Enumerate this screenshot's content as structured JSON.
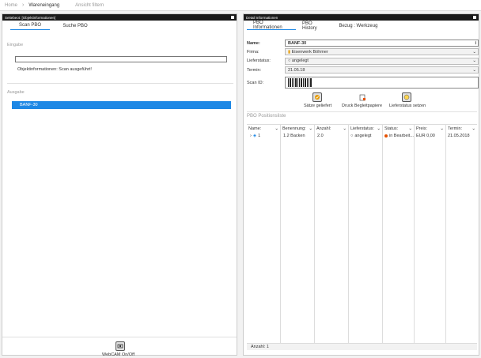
{
  "topbar": {
    "home": "Home",
    "current": "Wareneingang",
    "filter": "Ansicht filtern"
  },
  "left_panel": {
    "header": "Seitebeot: [Objektinformationen]",
    "tabs": [
      "Scan PBO",
      "Suche PBO"
    ],
    "eingabe_title": "Eingabe",
    "status_text": "Objektinformationen: Scan ausgeführt!",
    "ausgabe_title": "Ausgabe",
    "ausgabe_items": [
      "BANF-30"
    ],
    "webcam_label": "WebCAM On/Off"
  },
  "right_panel": {
    "header": "Detail Informationen",
    "tabs": [
      "PBO Informationen",
      "PBO History",
      "Bezug : Werkzeug"
    ],
    "form": {
      "name_label": "Name:",
      "name_value": "BANF-30",
      "firma_label": "Firma:",
      "firma_value": "Eisenwerk Böhmer",
      "lieferstatus_label": "Lieferstatus:",
      "lieferstatus_value": "angelegt",
      "termin_label": "Termin:",
      "termin_value": "21.05.18",
      "scan_label": "Scan ID:"
    },
    "actions": [
      "Sätze geliefert",
      "Druck Begleitpapiere",
      "Lieferstatus setzen"
    ],
    "positions_title": "PBO Positionsliste",
    "columns": [
      "Name:",
      "Benennung:",
      "Anzahl:",
      "Lieferstatus:",
      "Status:",
      "Preis:",
      "Termin:"
    ],
    "rows": [
      {
        "name": "1",
        "benennung": "1.2 Backen",
        "anzahl": "2.0",
        "lieferstatus": "angelegt",
        "status": "in Bearbeit...",
        "preis": "EUR 0,00",
        "termin": "21.05.2018"
      }
    ],
    "footer": "Anzahl: 1"
  },
  "colors": {
    "accent": "#1e88e5",
    "header_bg": "#1a1a1a",
    "status_dot": "#e65100"
  }
}
